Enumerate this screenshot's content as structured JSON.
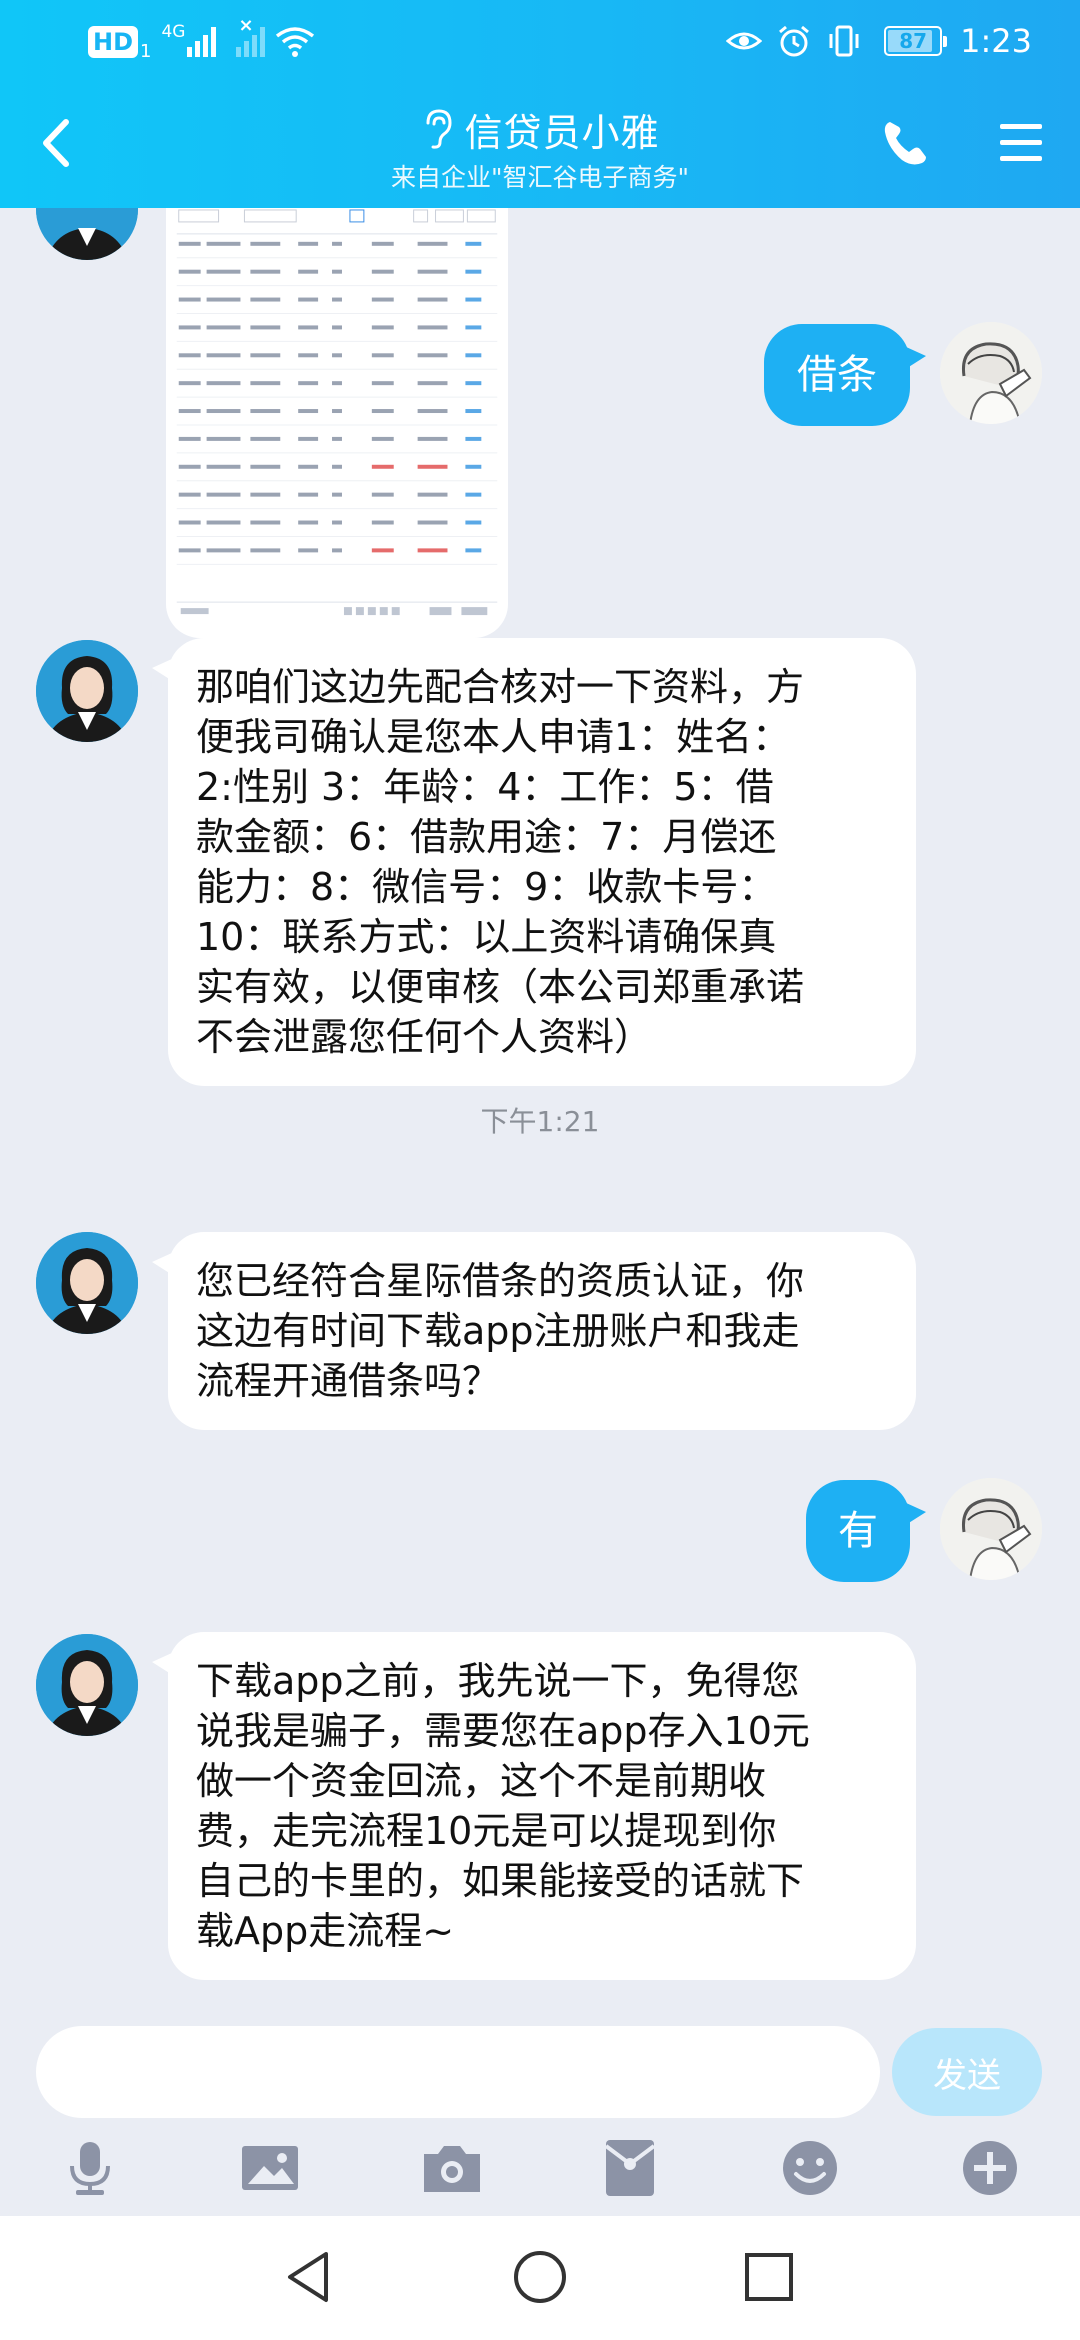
{
  "status_bar": {
    "hd": "HD",
    "sim": "1",
    "network": "4G",
    "battery": "87",
    "battery_level": 0.87,
    "time": "1:23"
  },
  "header": {
    "title": "信贷员小雅",
    "subtitle": "来自企业\"智汇谷电子商务\""
  },
  "messages": [
    {
      "from": "user",
      "text": "借条"
    },
    {
      "from": "agent",
      "lines": [
        "那咱们这边先配合核对一下资料，方",
        "便我司确认是您本人申请1：姓名：",
        "2:性别 3：年龄：4：工作：5：借",
        "款金额：6：借款用途：7：月偿还",
        "能力：8：微信号：9：收款卡号：",
        "10：联系方式：以上资料请确保真",
        "实有效，以便审核（本公司郑重承诺",
        "不会泄露您任何个人资料）"
      ]
    },
    {
      "timestamp": "下午1:21"
    },
    {
      "from": "agent",
      "lines": [
        "您已经符合星际借条的资质认证，你",
        "这边有时间下载app注册账户和我走",
        "流程开通借条吗？"
      ]
    },
    {
      "from": "user",
      "text": "有"
    },
    {
      "from": "agent",
      "lines": [
        "下载app之前，我先说一下，免得您",
        "说我是骗子，需要您在app存入10元",
        "做一个资金回流，这个不是前期收",
        "费，走完流程10元是可以提现到你",
        "自己的卡里的，如果能接受的话就下",
        "载App走流程~"
      ]
    }
  ],
  "input": {
    "value": "",
    "send_label": "发送"
  },
  "toolbar": [
    "microphone-icon",
    "image-icon",
    "camera-icon",
    "red-packet-icon",
    "emoji-icon",
    "plus-icon"
  ],
  "colors": {
    "header": "#18b8f5",
    "bubble_out": "#1eb0f3",
    "background": "#eaedf4",
    "send_disabled": "#b8e6fb",
    "toolbar_icon": "#8c93a6"
  }
}
